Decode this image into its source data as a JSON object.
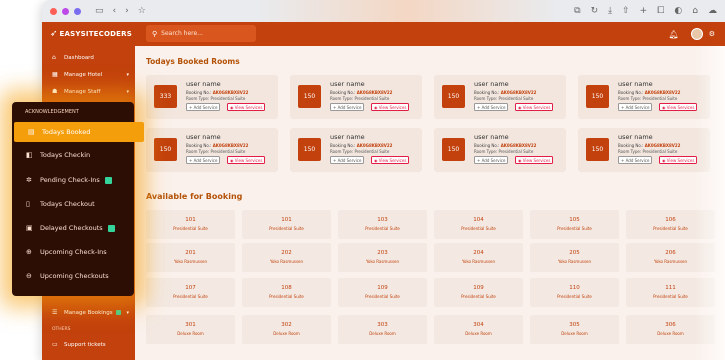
{
  "app": {
    "logo_text": "EASYSITECODERS"
  },
  "search": {
    "placeholder": "Search here..."
  },
  "sidebar": {
    "items": [
      {
        "label": "Dashboard"
      },
      {
        "label": "Manage Hotel"
      },
      {
        "label": "Manage Staff"
      },
      {
        "label": "Manage Bookings"
      }
    ],
    "others_label": "OTHERS",
    "support_label": "Support tickets"
  },
  "menu": {
    "header": "ACKNOWLEDGEMENT",
    "items": [
      {
        "label": "Todays Booked"
      },
      {
        "label": "Todays Checkin"
      },
      {
        "label": "Pending Check-Ins"
      },
      {
        "label": "Todays Checkout"
      },
      {
        "label": "Delayed Checkouts"
      },
      {
        "label": "Upcoming Check-Ins"
      },
      {
        "label": "Upcoming Checkouts"
      }
    ]
  },
  "main": {
    "booked_title": "Todays Booked Rooms",
    "available_title": "Available for Booking",
    "booked_cards": [
      {
        "room": "333",
        "name": "user name",
        "booking_label": "Booking No.:",
        "booking_no": "AK0G8KBX8V22",
        "room_type": "Room Type: Presidential Suite",
        "add_label": "+ Add Service",
        "view_label": "View Services"
      },
      {
        "room": "150",
        "name": "user name",
        "booking_label": "Booking No.:",
        "booking_no": "AK0G8KBX8V22",
        "room_type": "Room Type: Presidential Suite",
        "add_label": "+ Add Service",
        "view_label": "View Services"
      },
      {
        "room": "150",
        "name": "user name",
        "booking_label": "Booking No.:",
        "booking_no": "AK0G8KBX8V22",
        "room_type": "Room Type: Presidential Suite",
        "add_label": "+ Add Service",
        "view_label": "View Services"
      },
      {
        "room": "150",
        "name": "user name",
        "booking_label": "Booking No.:",
        "booking_no": "AK0G8KBX8V22",
        "room_type": "Room Type: Presidential Suite",
        "add_label": "+ Add Service",
        "view_label": "View Services"
      },
      {
        "room": "150",
        "name": "user name",
        "booking_label": "Booking No.:",
        "booking_no": "AK0G8KBX8V22",
        "room_type": "Room Type: Presidential Suite",
        "add_label": "+ Add Service",
        "view_label": "View Services"
      },
      {
        "room": "150",
        "name": "user name",
        "booking_label": "Booking No.:",
        "booking_no": "AK0G8KBX8V22",
        "room_type": "Room Type: Presidential Suite",
        "add_label": "+ Add Service",
        "view_label": "View Services"
      },
      {
        "room": "150",
        "name": "user name",
        "booking_label": "Booking No.:",
        "booking_no": "AK0G8KBX8V22",
        "room_type": "Room Type: Presidential Suite",
        "add_label": "+ Add Service",
        "view_label": "View Services"
      },
      {
        "room": "150",
        "name": "user name",
        "booking_label": "Booking No.:",
        "booking_no": "AK0G8KBX8V22",
        "room_type": "Room Type: Presidential Suite",
        "add_label": "+ Add Service",
        "view_label": "View Services"
      }
    ],
    "available_rooms": [
      {
        "number": "101",
        "type": "Presidential Suite"
      },
      {
        "number": "101",
        "type": "Presidential Suite"
      },
      {
        "number": "103",
        "type": "Presidential Suite"
      },
      {
        "number": "104",
        "type": "Presidential Suite"
      },
      {
        "number": "105",
        "type": "Presidential Suite"
      },
      {
        "number": "106",
        "type": "Presidential Suite"
      },
      {
        "number": "201",
        "type": "Yoko Rasmussen"
      },
      {
        "number": "202",
        "type": "Yoko Rasmussen"
      },
      {
        "number": "203",
        "type": "Yoko Rasmussen"
      },
      {
        "number": "204",
        "type": "Yoko Rasmussen"
      },
      {
        "number": "205",
        "type": "Yoko Rasmussen"
      },
      {
        "number": "206",
        "type": "Yoko Rasmussen"
      },
      {
        "number": "107",
        "type": "Presidential Suite"
      },
      {
        "number": "108",
        "type": "Presidential Suite"
      },
      {
        "number": "109",
        "type": "Presidential Suite"
      },
      {
        "number": "109",
        "type": "Presidential Suite"
      },
      {
        "number": "110",
        "type": "Presidential Suite"
      },
      {
        "number": "111",
        "type": "Presidential Suite"
      },
      {
        "number": "301",
        "type": "Deluxe Room"
      },
      {
        "number": "302",
        "type": "Deluxe Room"
      },
      {
        "number": "303",
        "type": "Deluxe Room"
      },
      {
        "number": "304",
        "type": "Deluxe Room"
      },
      {
        "number": "305",
        "type": "Deluxe Room"
      },
      {
        "number": "306",
        "type": "Deluxe Room"
      }
    ]
  },
  "colors": {
    "brand": "#c2410c",
    "menu_bg": "#2c0e05",
    "menu_active": "#f59e0b",
    "badge": "#34d399"
  }
}
